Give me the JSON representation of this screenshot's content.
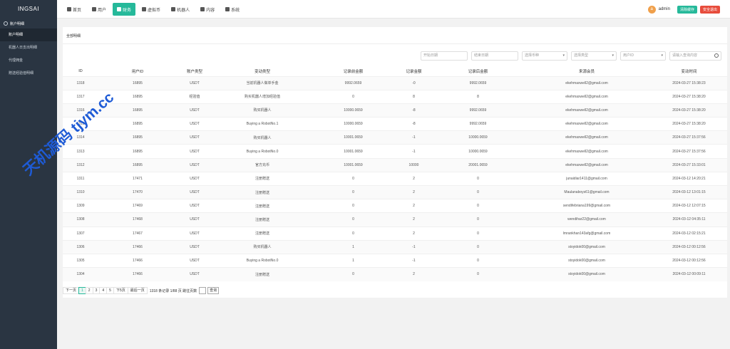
{
  "brand": "INGSAI",
  "sidebar": {
    "group": "账户明细",
    "items": [
      {
        "label": "账户明细",
        "active": true
      },
      {
        "label": "机器人日支出明细",
        "active": false
      },
      {
        "label": "代理佣金",
        "active": false
      },
      {
        "label": "赠送经验值明细",
        "active": false
      }
    ]
  },
  "nav": [
    {
      "label": "首页",
      "icon": "home-icon",
      "active": false
    },
    {
      "label": "用户",
      "icon": "user-icon",
      "active": false
    },
    {
      "label": "财务",
      "icon": "wallet-icon",
      "active": true
    },
    {
      "label": "虚拟币",
      "icon": "database-icon",
      "active": false
    },
    {
      "label": "机器人",
      "icon": "robot-icon",
      "active": false
    },
    {
      "label": "内容",
      "icon": "document-icon",
      "active": false
    },
    {
      "label": "系统",
      "icon": "gear-icon",
      "active": false
    }
  ],
  "user": {
    "avatar_letter": "a",
    "name": "admin",
    "clear_cache": "清除缓存",
    "logout": "安全退出"
  },
  "card_title": "全部明细",
  "filters": {
    "start_date": "开始日期",
    "end_date": "结束日期",
    "coin": "选择币种",
    "type": "选择类型",
    "user_id": "用户ID",
    "search": "请输入查询内容"
  },
  "table": {
    "headers": [
      "ID",
      "用户ID",
      "账户类型",
      "变动类型",
      "记录前金额",
      "记录金额",
      "记录后金额",
      "来源会员",
      "变动时间"
    ],
    "rows": [
      [
        "1318",
        "16895",
        "USDT",
        "当前机器人做单手金",
        "9992.0659",
        "-0",
        "9992.0659",
        "ekehmaxwell2@gmail.com",
        "2024-03-27 15:38:23"
      ],
      [
        "1317",
        "16895",
        "经验值",
        "购买机器人增加经验值",
        "0",
        "8",
        "8",
        "ekehmaxwell2@gmail.com",
        "2024-03-27 15:38:20"
      ],
      [
        "1316",
        "16895",
        "USDT",
        "购买机器人",
        "10000.0659",
        "-8",
        "9992.0659",
        "ekehmaxwell2@gmail.com",
        "2024-03-27 15:38:20"
      ],
      [
        "1315",
        "16895",
        "USDT",
        "Buying a RobotNo.1",
        "10000.0659",
        "-8",
        "9992.0659",
        "ekehmaxwell2@gmail.com",
        "2024-03-27 15:38:20"
      ],
      [
        "1314",
        "16895",
        "USDT",
        "购买机器人",
        "10001.0659",
        "-1",
        "10000.0659",
        "ekehmaxwell2@gmail.com",
        "2024-03-27 15:37:56"
      ],
      [
        "1313",
        "16895",
        "USDT",
        "Buying a RobotNo.0",
        "10001.0659",
        "-1",
        "10000.0659",
        "ekehmaxwell2@gmail.com",
        "2024-03-27 15:37:56"
      ],
      [
        "1312",
        "16895",
        "USDT",
        "官方充币",
        "10001.0659",
        "10000",
        "20001.0659",
        "ekehmaxwell2@gmail.com",
        "2024-03-27 15:33:01"
      ],
      [
        "1311",
        "17471",
        "USDT",
        "注册赠送",
        "0",
        "2",
        "0",
        "junaidiar1411@gmail.com",
        "2024-03-12 14:20:21"
      ],
      [
        "1310",
        "17470",
        "USDT",
        "注册赠送",
        "0",
        "2",
        "0",
        "Maulanaboys61@gmail.com",
        "2024-03-12 13:01:15"
      ],
      [
        "1309",
        "17469",
        "USDT",
        "注册赠送",
        "0",
        "2",
        "0",
        "sendifebriana199@gmail.com",
        "2024-03-12 12:07:15"
      ],
      [
        "1308",
        "17468",
        "USDT",
        "注册赠送",
        "0",
        "2",
        "0",
        "wendihar22@gmail.com",
        "2024-03-12 04:35:11"
      ],
      [
        "1307",
        "17467",
        "USDT",
        "注册赠送",
        "0",
        "2",
        "0",
        "lmrankhan143afg@gmail.com",
        "2024-03-12 02:15:21"
      ],
      [
        "1306",
        "17466",
        "USDT",
        "购买机器人",
        "1",
        "-1",
        "0",
        "stoyidok00@gmail.com",
        "2024-03-12 00:12:56"
      ],
      [
        "1305",
        "17466",
        "USDT",
        "Buying a RobotNo.0",
        "1",
        "-1",
        "0",
        "stoyidok00@gmail.com",
        "2024-03-12 00:12:56"
      ],
      [
        "1304",
        "17466",
        "USDT",
        "注册赠送",
        "0",
        "2",
        "0",
        "stoyidok00@gmail.com",
        "2024-03-12 00:09:11"
      ]
    ]
  },
  "pager": {
    "prev": "下一页",
    "pages": [
      "1",
      "2",
      "3",
      "4",
      "5"
    ],
    "current": "1",
    "next": "下5页",
    "last": "最后一页",
    "info": "1318 条记录 1/88 页 跳往页数",
    "go": "查询"
  },
  "watermark": "天机源码 tjym.cc"
}
